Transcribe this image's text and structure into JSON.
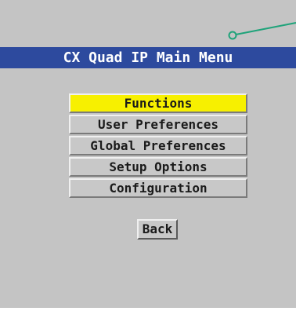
{
  "title": "CX Quad IP Main Menu",
  "menu": {
    "items": [
      {
        "label": "Functions",
        "selected": true
      },
      {
        "label": "User Preferences",
        "selected": false
      },
      {
        "label": "Global Preferences",
        "selected": false
      },
      {
        "label": "Setup Options",
        "selected": false
      },
      {
        "label": "Configuration",
        "selected": false
      }
    ]
  },
  "back_label": "Back",
  "colors": {
    "panel_background": "#c4c4c4",
    "title_bar": "#2d4a9e",
    "title_text": "#ffffff",
    "selected_item": "#f7f000",
    "callout_line": "#1fa37a"
  }
}
